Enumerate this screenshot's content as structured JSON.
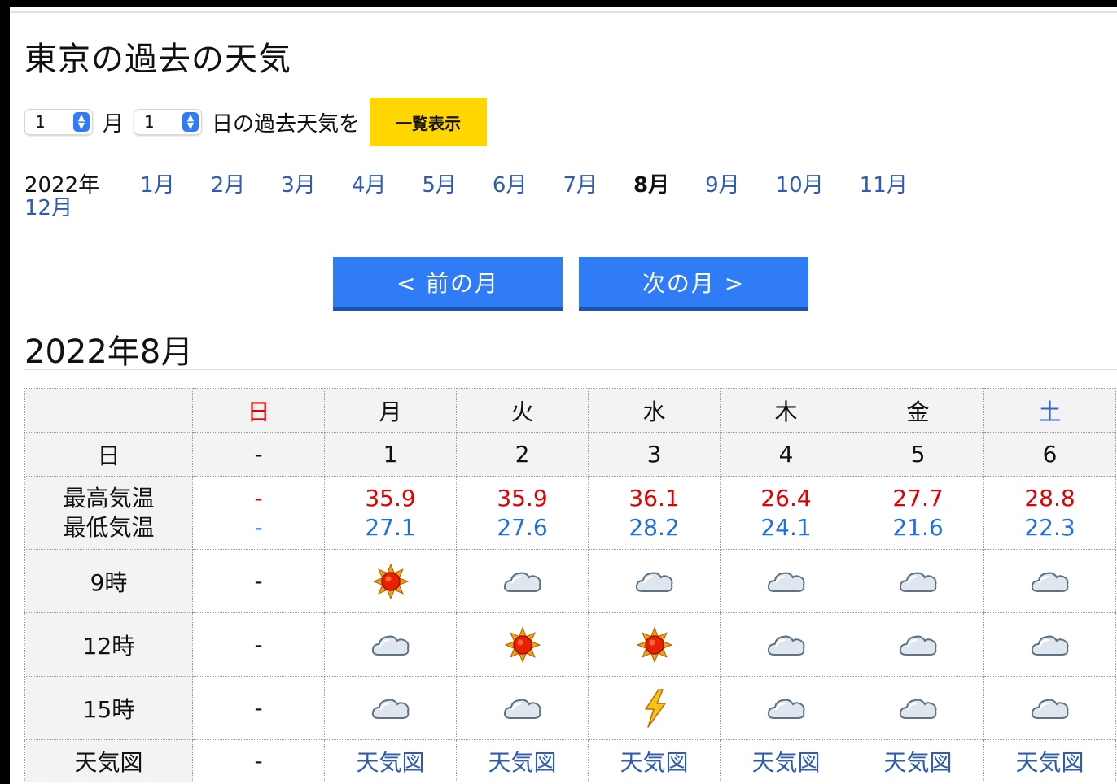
{
  "page": {
    "title": "東京の過去の天気"
  },
  "picker": {
    "month_value": "1",
    "month_label": "月",
    "day_value": "1",
    "day_label": "日の過去天気を",
    "button": "一覧表示"
  },
  "month_nav": {
    "year": "2022年",
    "months": [
      "1月",
      "2月",
      "3月",
      "4月",
      "5月",
      "6月",
      "7月",
      "8月",
      "9月",
      "10月",
      "11月",
      "12月"
    ],
    "current": "8月"
  },
  "nav": {
    "prev": "< 前の月",
    "next": "次の月 >"
  },
  "section_title": "2022年8月",
  "table": {
    "weekdays": [
      "日",
      "月",
      "火",
      "水",
      "木",
      "金",
      "土"
    ],
    "row_labels": {
      "date": "日",
      "max": "最高気温",
      "min": "最低気温",
      "t9": "9時",
      "t12": "12時",
      "t15": "15時",
      "map": "天気図"
    },
    "dash": "-",
    "days": [
      {
        "date": "-",
        "max": "-",
        "min": "-",
        "t9": "-",
        "t12": "-",
        "t15": "-",
        "map": "-"
      },
      {
        "date": "1",
        "max": "35.9",
        "min": "27.1",
        "t9": "sun",
        "t12": "cloud",
        "t15": "cloud",
        "map": "天気図"
      },
      {
        "date": "2",
        "max": "35.9",
        "min": "27.6",
        "t9": "cloud",
        "t12": "sun",
        "t15": "cloud",
        "map": "天気図"
      },
      {
        "date": "3",
        "max": "36.1",
        "min": "28.2",
        "t9": "cloud",
        "t12": "sun",
        "t15": "thunder",
        "map": "天気図"
      },
      {
        "date": "4",
        "max": "26.4",
        "min": "24.1",
        "t9": "cloud",
        "t12": "cloud",
        "t15": "cloud",
        "map": "天気図"
      },
      {
        "date": "5",
        "max": "27.7",
        "min": "21.6",
        "t9": "cloud",
        "t12": "cloud",
        "t15": "cloud",
        "map": "天気図"
      },
      {
        "date": "6",
        "max": "28.8",
        "min": "22.3",
        "t9": "cloud",
        "t12": "cloud",
        "t15": "cloud",
        "map": "天気図"
      }
    ]
  },
  "colors": {
    "accent": "#2f7cf6",
    "button_yellow": "#ffd600",
    "high": "#e00000",
    "low": "#1f6fe0",
    "link": "#2f5bb0"
  }
}
